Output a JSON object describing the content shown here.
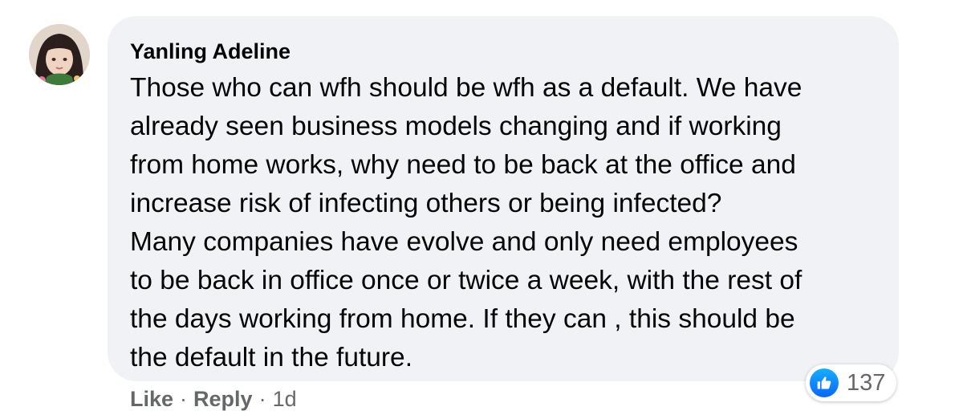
{
  "comment": {
    "author": "Yanling Adeline",
    "lines": [
      "Those who can wfh should be wfh as a default. We have",
      "already seen business models changing and if working",
      "from home works, why need to be back at the office and",
      "increase risk of infecting others or being infected?",
      "Many companies have evolve and only need employees",
      "to be back in office once or twice a week, with the rest of",
      "the days working from home. If they can , this should be",
      "the default in the future."
    ]
  },
  "reactions": {
    "icon": "thumbs-up-icon",
    "count": "137",
    "accent": "#0866ff"
  },
  "actions": {
    "like_label": "Like",
    "reply_label": "Reply",
    "separator": "·",
    "timestamp": "1d"
  },
  "colors": {
    "bubble": "#f0f2f5",
    "text": "#050505",
    "muted": "#65676b"
  }
}
